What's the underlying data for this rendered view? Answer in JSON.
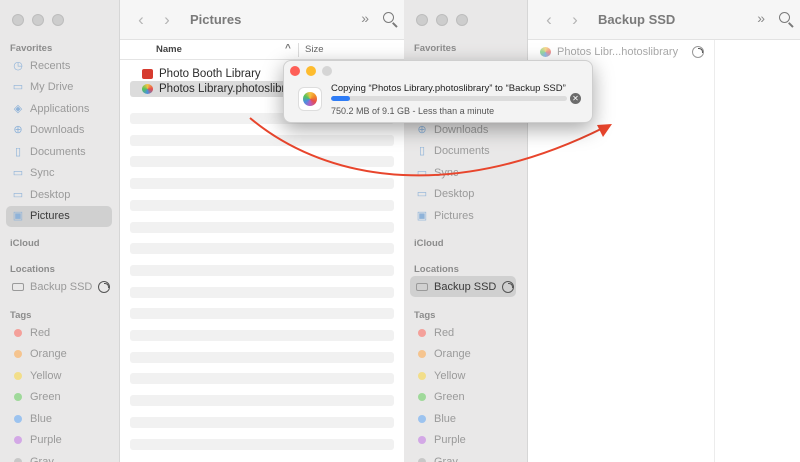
{
  "left_window": {
    "title": "Pictures",
    "sidebar": {
      "favorites_header": "Favorites",
      "favorites": [
        {
          "label": "Recents",
          "icon": "clock-icon"
        },
        {
          "label": "My Drive",
          "icon": "folder-icon"
        },
        {
          "label": "Applications",
          "icon": "applications-icon"
        },
        {
          "label": "Downloads",
          "icon": "download-icon"
        },
        {
          "label": "Documents",
          "icon": "document-icon"
        },
        {
          "label": "Sync",
          "icon": "folder-icon"
        },
        {
          "label": "Desktop",
          "icon": "desktop-icon"
        },
        {
          "label": "Pictures",
          "icon": "photo-icon",
          "selected": true
        }
      ],
      "icloud_header": "iCloud",
      "locations_header": "Locations",
      "locations": [
        {
          "label": "Backup SSD",
          "icon": "disk-icon"
        }
      ],
      "tags_header": "Tags",
      "tags": [
        {
          "label": "Red",
          "color": "#f4a09a"
        },
        {
          "label": "Orange",
          "color": "#f5c48f"
        },
        {
          "label": "Yellow",
          "color": "#f2de8a"
        },
        {
          "label": "Green",
          "color": "#9fd99a"
        },
        {
          "label": "Blue",
          "color": "#9cc3ef"
        },
        {
          "label": "Purple",
          "color": "#d3a8e6"
        },
        {
          "label": "Gray",
          "color": "#c8c8c8"
        }
      ]
    },
    "columns": {
      "name": "Name",
      "size": "Size"
    },
    "files": [
      {
        "name": "Photo Booth Library",
        "icon": "photo-booth-icon"
      },
      {
        "name": "Photos Library.photoslibrary",
        "icon": "photos-icon",
        "selected": true
      }
    ]
  },
  "right_window": {
    "title": "Backup SSD",
    "sidebar": {
      "favorites_header": "Favorites",
      "favorites": [
        {
          "label": "Downloads",
          "icon": "download-icon"
        },
        {
          "label": "Documents",
          "icon": "document-icon"
        },
        {
          "label": "Sync",
          "icon": "folder-icon"
        },
        {
          "label": "Desktop",
          "icon": "desktop-icon"
        },
        {
          "label": "Pictures",
          "icon": "photo-icon"
        }
      ],
      "icloud_header": "iCloud",
      "locations_header": "Locations",
      "locations": [
        {
          "label": "Backup SSD",
          "icon": "disk-icon",
          "selected": true
        }
      ],
      "tags_header": "Tags",
      "tags": [
        {
          "label": "Red",
          "color": "#f4a09a"
        },
        {
          "label": "Orange",
          "color": "#f5c48f"
        },
        {
          "label": "Yellow",
          "color": "#f2de8a"
        },
        {
          "label": "Green",
          "color": "#9fd99a"
        },
        {
          "label": "Blue",
          "color": "#9cc3ef"
        },
        {
          "label": "Purple",
          "color": "#d3a8e6"
        },
        {
          "label": "Gray",
          "color": "#c8c8c8"
        }
      ]
    },
    "files": [
      {
        "name": "Photos Libr...hotoslibrary",
        "icon": "photos-icon"
      }
    ]
  },
  "copy_dialog": {
    "title": "Copying “Photos Library.photoslibrary” to “Backup SSD”",
    "status": "750.2 MB of 9.1 GB - Less than a minute",
    "progress_percent": 8,
    "progress_color": "#2e7cf6"
  },
  "annotation": {
    "arrow_color": "#e8452c"
  }
}
